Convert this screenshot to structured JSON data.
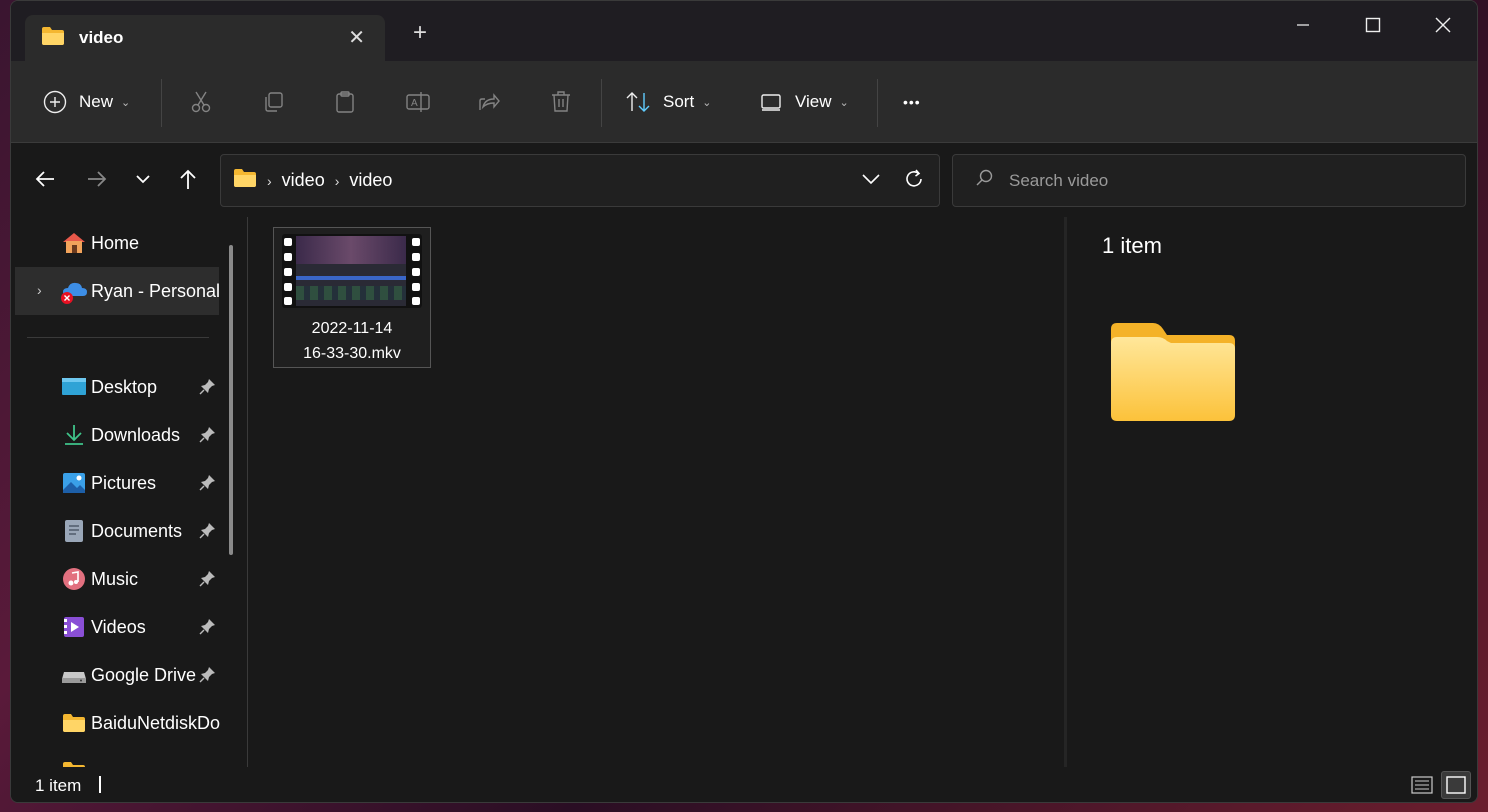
{
  "window": {
    "tab_title": "video",
    "tab_close": "✕",
    "new_tab": "+"
  },
  "toolbar": {
    "new_label": "New",
    "sort_label": "Sort",
    "view_label": "View",
    "more_label": "•••"
  },
  "address": {
    "crumbs": [
      "video",
      "video"
    ],
    "separator": "›"
  },
  "search": {
    "placeholder": "Search video"
  },
  "sidebar": {
    "home": "Home",
    "onedrive": "Ryan - Personal",
    "items": [
      {
        "label": "Desktop",
        "icon": "desktop-icon",
        "pinned": true
      },
      {
        "label": "Downloads",
        "icon": "download-icon",
        "pinned": true
      },
      {
        "label": "Pictures",
        "icon": "pictures-icon",
        "pinned": true
      },
      {
        "label": "Documents",
        "icon": "documents-icon",
        "pinned": true
      },
      {
        "label": "Music",
        "icon": "music-icon",
        "pinned": true
      },
      {
        "label": "Videos",
        "icon": "videos-icon",
        "pinned": true
      },
      {
        "label": "Google Drive",
        "icon": "drive-icon",
        "pinned": true
      },
      {
        "label": "BaiduNetdiskDo",
        "icon": "folder-icon",
        "pinned": false
      }
    ]
  },
  "files": [
    {
      "name_line1": "2022-11-14",
      "name_line2": "16-33-30.mkv",
      "type": "video"
    }
  ],
  "details": {
    "count": "1 item"
  },
  "status": {
    "count": "1 item"
  },
  "colors": {
    "window_bg": "#191919",
    "toolbar_bg": "#2b2b2b",
    "folder_yellow": "#ffc83d",
    "onedrive_blue": "#3d8ee6",
    "error_red": "#e81123"
  }
}
